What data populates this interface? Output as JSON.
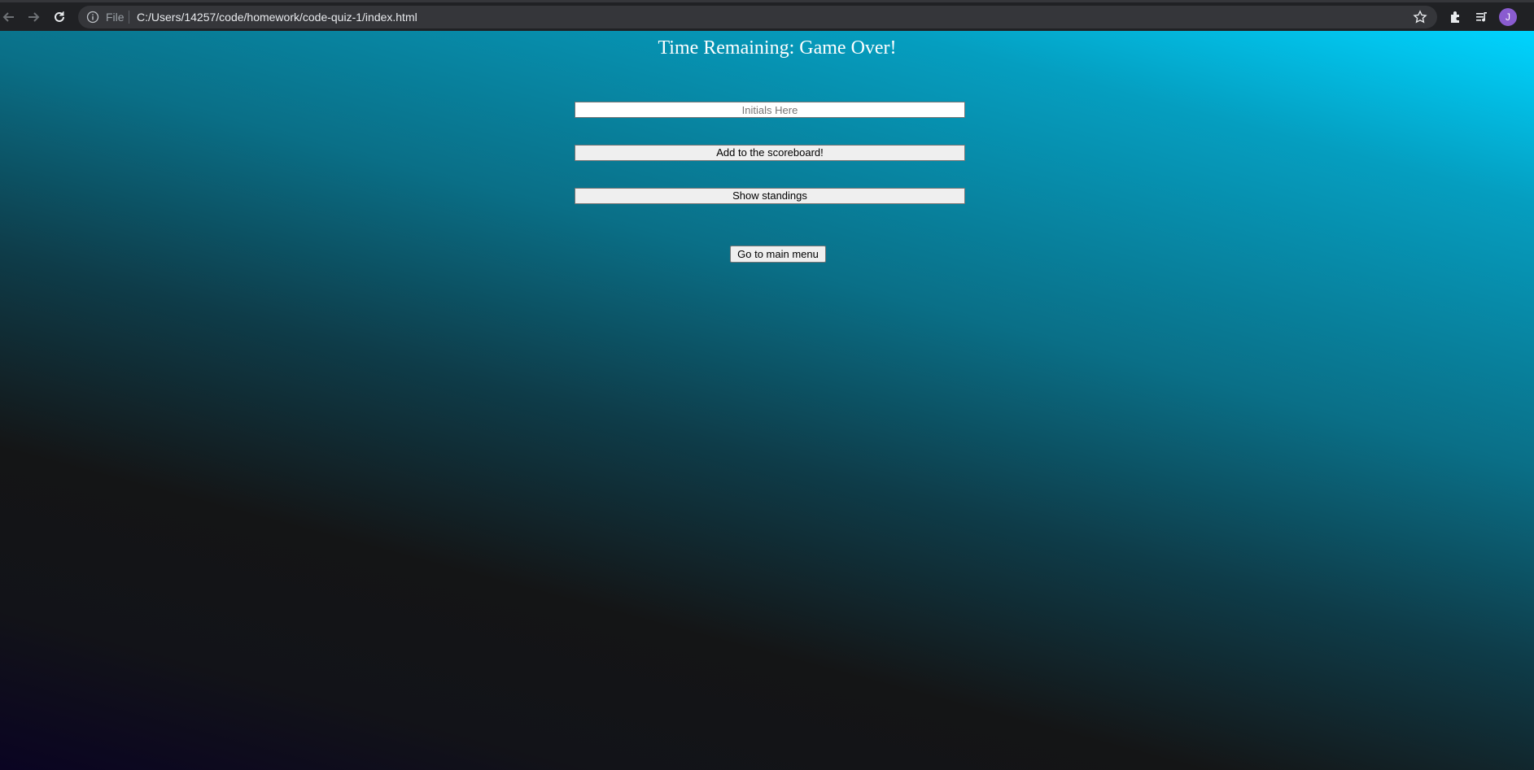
{
  "browser": {
    "info_icon": "info-icon",
    "scheme_label": "File",
    "url": "C:/Users/14257/code/homework/code-quiz-1/index.html",
    "avatar_letter": "J",
    "icons": [
      "back-arrow-icon",
      "forward-arrow-icon",
      "reload-icon",
      "star-icon",
      "extensions-icon",
      "media-queue-icon"
    ]
  },
  "page": {
    "title": "Time Remaining: Game Over!",
    "initials_placeholder": "Initials Here",
    "add_button_label": "Add to the scoreboard!",
    "standings_button_label": "Show standings",
    "menu_button_label": "Go to main menu"
  },
  "colors": {
    "gradient_top": "#00d4ff",
    "gradient_bottom": "#0a0422",
    "title_text": "#ffffff"
  }
}
